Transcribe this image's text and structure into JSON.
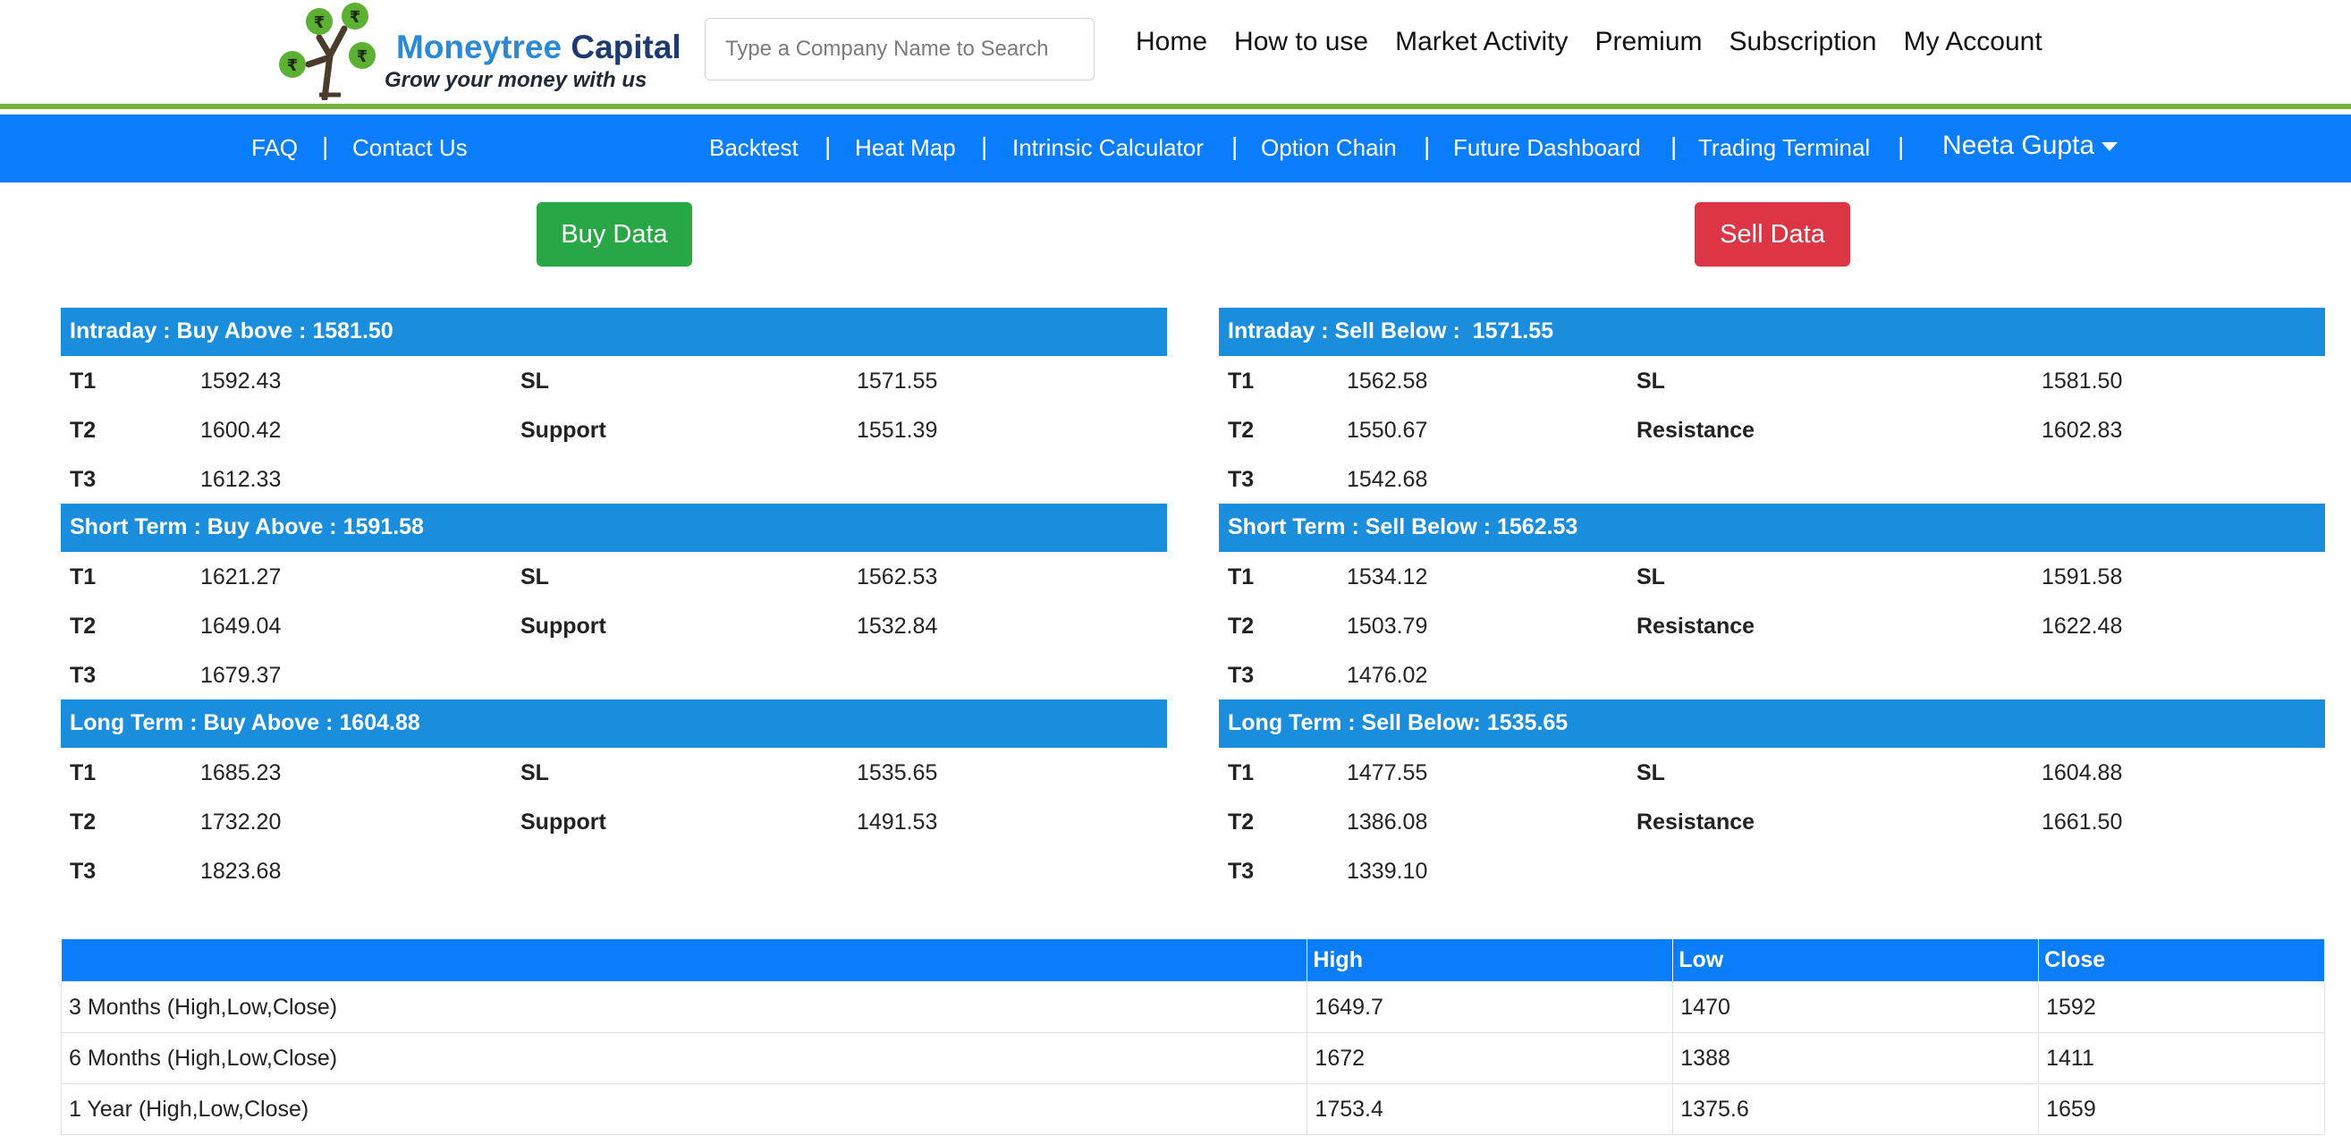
{
  "brand": {
    "name1": "Moneytree",
    "name2": "Capital",
    "tagline": "Grow your money with us"
  },
  "search": {
    "placeholder": "Type a Company Name to Search"
  },
  "main_nav": [
    "Home",
    "How to use",
    "Market Activity",
    "Premium",
    "Subscription",
    "My Account"
  ],
  "sub_nav": {
    "left": [
      "FAQ",
      "Contact Us"
    ],
    "right": [
      "Backtest",
      "Heat Map",
      "Intrinsic Calculator",
      "Option Chain",
      "Future Dashboard",
      "Trading Terminal"
    ],
    "separator": "|",
    "user": "Neeta Gupta"
  },
  "buttons": {
    "buy": "Buy Data",
    "sell": "Sell Data"
  },
  "colors": {
    "nav_blue": "#0a7dfb",
    "section_blue": "#1b8ddd",
    "buy_green": "#28a745",
    "sell_red": "#dc3545",
    "accent_green": "#74b43c"
  },
  "buy": {
    "sections": [
      {
        "title": "Intraday : Buy Above : 1581.50",
        "rows": [
          {
            "t": "T1",
            "v": "1592.43",
            "k": "SL",
            "kv": "1571.55"
          },
          {
            "t": "T2",
            "v": "1600.42",
            "k": "Support",
            "kv": "1551.39"
          },
          {
            "t": "T3",
            "v": "1612.33",
            "k": "",
            "kv": ""
          }
        ]
      },
      {
        "title": "Short Term : Buy Above : 1591.58",
        "rows": [
          {
            "t": "T1",
            "v": "1621.27",
            "k": "SL",
            "kv": "1562.53"
          },
          {
            "t": "T2",
            "v": "1649.04",
            "k": "Support",
            "kv": "1532.84"
          },
          {
            "t": "T3",
            "v": "1679.37",
            "k": "",
            "kv": ""
          }
        ]
      },
      {
        "title": "Long Term : Buy Above : 1604.88",
        "rows": [
          {
            "t": "T1",
            "v": "1685.23",
            "k": "SL",
            "kv": "1535.65"
          },
          {
            "t": "T2",
            "v": "1732.20",
            "k": "Support",
            "kv": "1491.53"
          },
          {
            "t": "T3",
            "v": "1823.68",
            "k": "",
            "kv": ""
          }
        ]
      }
    ]
  },
  "sell": {
    "sections": [
      {
        "title": "Intraday : Sell Below :  1571.55",
        "rows": [
          {
            "t": "T1",
            "v": "1562.58",
            "k": "SL",
            "kv": "1581.50"
          },
          {
            "t": "T2",
            "v": "1550.67",
            "k": "Resistance",
            "kv": "1602.83"
          },
          {
            "t": "T3",
            "v": "1542.68",
            "k": "",
            "kv": ""
          }
        ]
      },
      {
        "title": "Short Term : Sell Below : 1562.53",
        "rows": [
          {
            "t": "T1",
            "v": "1534.12",
            "k": "SL",
            "kv": "1591.58"
          },
          {
            "t": "T2",
            "v": "1503.79",
            "k": "Resistance",
            "kv": "1622.48"
          },
          {
            "t": "T3",
            "v": "1476.02",
            "k": "",
            "kv": ""
          }
        ]
      },
      {
        "title": "Long Term : Sell Below: 1535.65",
        "rows": [
          {
            "t": "T1",
            "v": "1477.55",
            "k": "SL",
            "kv": "1604.88"
          },
          {
            "t": "T2",
            "v": "1386.08",
            "k": "Resistance",
            "kv": "1661.50"
          },
          {
            "t": "T3",
            "v": "1339.10",
            "k": "",
            "kv": ""
          }
        ]
      }
    ]
  },
  "hlc_table": {
    "headers": [
      "",
      "High",
      "Low",
      "Close"
    ],
    "rows": [
      [
        "3 Months (High,Low,Close)",
        "1649.7",
        "1470",
        "1592"
      ],
      [
        "6 Months (High,Low,Close)",
        "1672",
        "1388",
        "1411"
      ],
      [
        "1 Year (High,Low,Close)",
        "1753.4",
        "1375.6",
        "1659"
      ]
    ]
  }
}
